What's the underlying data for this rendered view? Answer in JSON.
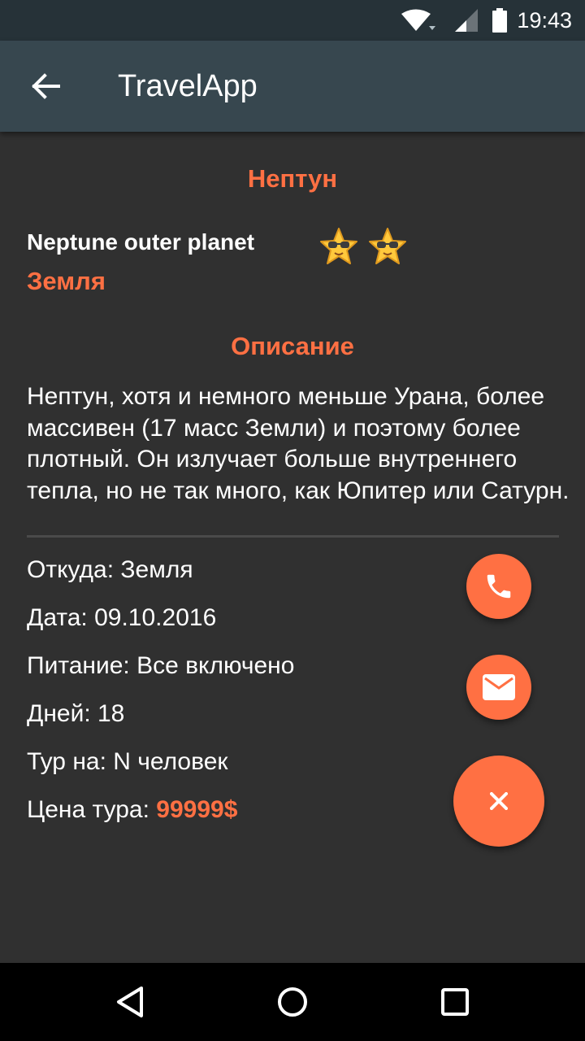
{
  "status_bar": {
    "time": "19:43",
    "icons": [
      "wifi-icon",
      "signal-icon",
      "battery-icon"
    ]
  },
  "app_bar": {
    "back_icon": "arrow-back-icon",
    "title": "TravelApp"
  },
  "tour": {
    "place_title": "Нептун",
    "subtitle": "Neptune outer planet",
    "rating_stars": 2,
    "origin": "Земля",
    "description_heading": "Описание",
    "description": "Нептун, хотя и немного меньше Урана, более массивен (17 масс Земли) и поэтому более плотный. Он излучает больше внутреннего тепла, но не так много, как Юпитер или Сатурн."
  },
  "details": {
    "from": "Откуда: Земля",
    "date": "Дата: 09.10.2016",
    "food": "Питание: Все включено",
    "days": "Дней: 18",
    "people": "Тур на: N человек",
    "price_label": "Цена тура:",
    "price_value": "99999$"
  },
  "fabs": {
    "phone_icon": "phone-icon",
    "mail_icon": "mail-icon",
    "close_icon": "close-icon"
  },
  "nav_bar": {
    "icons": [
      "nav-back-icon",
      "nav-home-icon",
      "nav-recents-icon"
    ]
  },
  "colors": {
    "accent": "#ff7043",
    "background": "#303030",
    "app_bar": "#37474f",
    "status_bar": "#263238"
  }
}
